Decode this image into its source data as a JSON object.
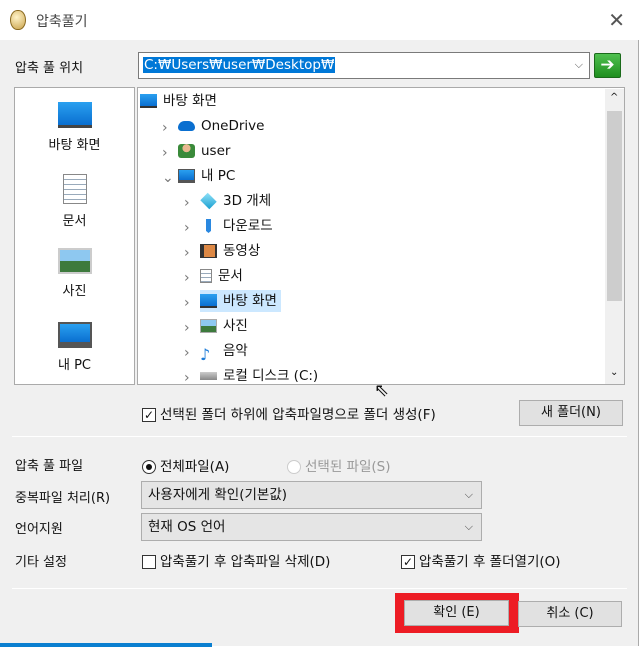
{
  "title": "압축풀기",
  "location": {
    "label": "압축 풀 위치",
    "path": "C:₩Users₩user₩Desktop₩"
  },
  "places": [
    {
      "label": "바탕 화면",
      "icon": "desktop-icon"
    },
    {
      "label": "문서",
      "icon": "document-icon"
    },
    {
      "label": "사진",
      "icon": "picture-icon"
    },
    {
      "label": "내 PC",
      "icon": "computer-icon"
    }
  ],
  "tree": [
    {
      "label": "바탕 화면",
      "level": 0,
      "icon": "desktop-icon"
    },
    {
      "label": "OneDrive",
      "level": 1,
      "icon": "cloud-icon",
      "expander": "collapsed"
    },
    {
      "label": "user",
      "level": 1,
      "icon": "user-icon",
      "expander": "collapsed"
    },
    {
      "label": "내 PC",
      "level": 1,
      "icon": "computer-icon",
      "expander": "expanded"
    },
    {
      "label": "3D 개체",
      "level": 2,
      "icon": "cube-icon",
      "expander": "collapsed"
    },
    {
      "label": "다운로드",
      "level": 2,
      "icon": "download-icon",
      "expander": "collapsed"
    },
    {
      "label": "동영상",
      "level": 2,
      "icon": "video-icon",
      "expander": "collapsed"
    },
    {
      "label": "문서",
      "level": 2,
      "icon": "document-icon",
      "expander": "collapsed"
    },
    {
      "label": "바탕 화면",
      "level": 2,
      "icon": "desktop-icon",
      "expander": "collapsed",
      "selected": true
    },
    {
      "label": "사진",
      "level": 2,
      "icon": "picture-icon",
      "expander": "collapsed"
    },
    {
      "label": "음악",
      "level": 2,
      "icon": "music-icon",
      "expander": "collapsed"
    },
    {
      "label": "로컬 디스크 (C:)",
      "level": 2,
      "icon": "drive-icon",
      "expander": "collapsed"
    }
  ],
  "create_subfolder": {
    "label": "선택된 폴더 하위에 압축파일명으로 폴더 생성(F)",
    "checked": true
  },
  "new_folder": "새 폴더(N)",
  "files": {
    "label": "압축 풀 파일",
    "all": "전체파일(A)",
    "selected": "선택된 파일(S)"
  },
  "duplicate": {
    "label": "중복파일 처리(R)",
    "value": "사용자에게 확인(기본값)"
  },
  "language": {
    "label": "언어지원",
    "value": "현재 OS 언어"
  },
  "other": {
    "label": "기타 설정",
    "delete_after": "압축풀기 후 압축파일 삭제(D)",
    "delete_checked": false,
    "open_after": "압축풀기 후 폴더열기(O)",
    "open_checked": true
  },
  "ok": "확인 (E)",
  "cancel": "취소 (C)",
  "colors": {
    "highlight": "#0078d7",
    "annotation": "#ed1c24"
  }
}
